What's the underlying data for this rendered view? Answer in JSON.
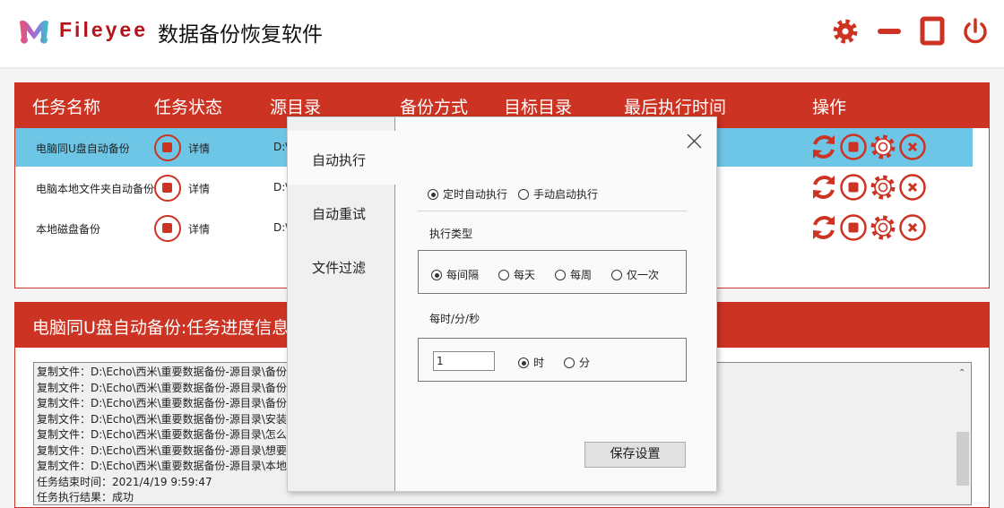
{
  "app": {
    "brand": "Fileyee",
    "title": "数据备份恢复软件"
  },
  "window_controls": [
    "gear-icon",
    "minimize-icon",
    "maximize-icon",
    "power-icon"
  ],
  "accent": "#cc3322",
  "table": {
    "headers": [
      "任务名称",
      "任务状态",
      "源目录",
      "备份方式",
      "目标目录",
      "最后执行时间",
      "操作"
    ],
    "rows": [
      {
        "name": "电脑同U盘自动备份",
        "detail": "详情",
        "src": "D:\\",
        "selected": true
      },
      {
        "name": "电脑本地文件夹自动备份",
        "detail": "详情",
        "src": "D:\\",
        "selected": false
      },
      {
        "name": "本地磁盘备份",
        "detail": "详情",
        "src": "D:\\",
        "selected": false
      }
    ],
    "actions": [
      "refresh-icon",
      "stop-icon",
      "settings-icon",
      "delete-icon"
    ]
  },
  "log": {
    "title": "电脑同U盘自动备份:任务进度信息",
    "lines": [
      "复制文件：D:\\Echo\\西米\\重要数据备份-源目录\\备份",
      "复制文件：D:\\Echo\\西米\\重要数据备份-源目录\\备份",
      "复制文件：D:\\Echo\\西米\\重要数据备份-源目录\\备份",
      "复制文件：D:\\Echo\\西米\\重要数据备份-源目录\\安装",
      "复制文件：D:\\Echo\\西米\\重要数据备份-源目录\\怎么",
      "复制文件：D:\\Echo\\西米\\重要数据备份-源目录\\想要",
      "复制文件：D:\\Echo\\西米\\重要数据备份-源目录\\本地",
      "任务结束时间：2021/4/19 9:59:47",
      "任务执行结果：成功"
    ]
  },
  "dialog": {
    "nav": [
      "自动执行",
      "自动重试",
      "文件过滤"
    ],
    "mode_options": [
      "定时自动执行",
      "手动启动执行"
    ],
    "mode_selected": "定时自动执行",
    "type_label": "执行类型",
    "type_options": [
      "每间隔",
      "每天",
      "每周",
      "仅一次"
    ],
    "type_selected": "每间隔",
    "interval_label": "每时/分/秒",
    "interval_value": "1",
    "unit_options": [
      "时",
      "分"
    ],
    "unit_selected": "时",
    "save_label": "保存设置"
  }
}
